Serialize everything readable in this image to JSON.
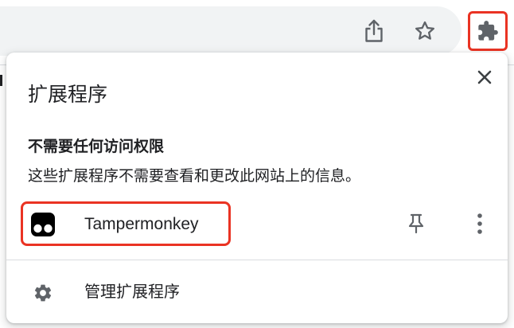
{
  "toolbar": {
    "share_icon": "share-icon",
    "bookmark_icon": "star-icon",
    "extensions_icon": "puzzle-piece-icon"
  },
  "panel": {
    "title": "扩展程序",
    "close_icon": "close-icon",
    "section_heading": "不需要任何访问权限",
    "section_description": "这些扩展程序不需要查看和更改此网站上的信息。",
    "extensions": [
      {
        "name": "Tampermonkey",
        "icon": "tampermonkey-icon"
      }
    ],
    "manage_label": "管理扩展程序",
    "manage_icon": "gear-icon"
  },
  "colors": {
    "highlight": "#ea3323",
    "text": "#202124",
    "icon": "#5f6368",
    "omnibox_bg": "#f1f3f4",
    "divider": "#dadce0"
  }
}
